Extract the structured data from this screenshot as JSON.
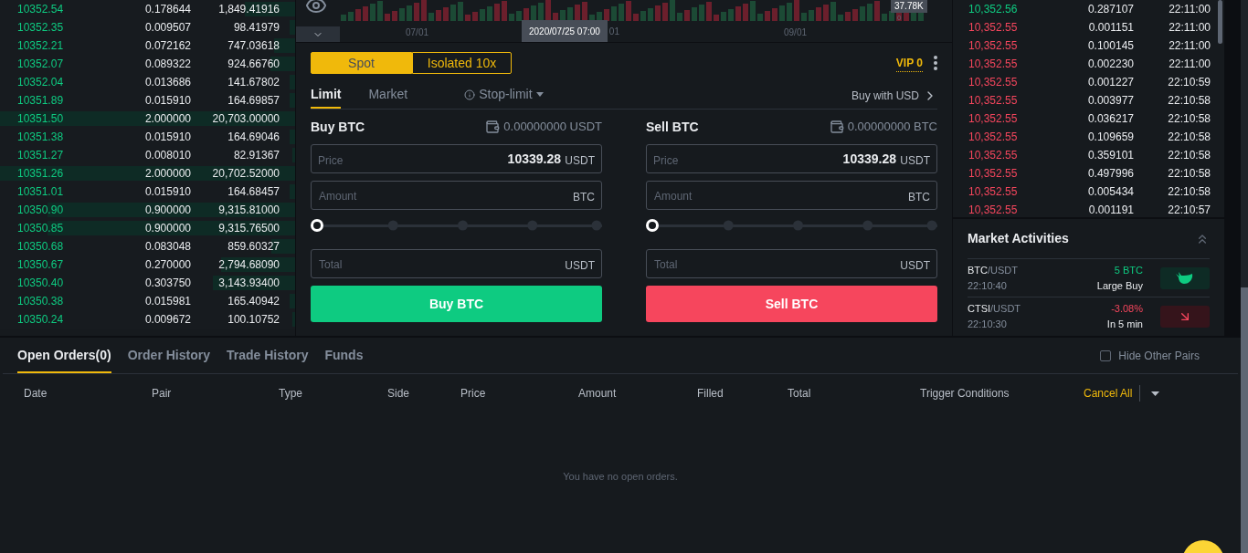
{
  "order_book": {
    "rows": [
      {
        "price": "10352.54",
        "amount": "0.178644",
        "total": "1,849.41916",
        "level": 0.17
      },
      {
        "price": "10352.35",
        "amount": "0.009507",
        "total": "98.41979",
        "level": 0.02
      },
      {
        "price": "10352.21",
        "amount": "0.072162",
        "total": "747.03618",
        "level": 0.07
      },
      {
        "price": "10352.07",
        "amount": "0.089322",
        "total": "924.66760",
        "level": 0.085
      },
      {
        "price": "10352.04",
        "amount": "0.013686",
        "total": "141.67802",
        "level": 0.02
      },
      {
        "price": "10351.89",
        "amount": "0.015910",
        "total": "164.69857",
        "level": 0.02
      },
      {
        "price": "10351.50",
        "amount": "2.000000",
        "total": "20,703.00000",
        "level": 1
      },
      {
        "price": "10351.38",
        "amount": "0.015910",
        "total": "164.69046",
        "level": 0.02
      },
      {
        "price": "10351.27",
        "amount": "0.008010",
        "total": "82.91367",
        "level": 0.01
      },
      {
        "price": "10351.26",
        "amount": "2.000000",
        "total": "20,702.52000",
        "level": 1
      },
      {
        "price": "10351.01",
        "amount": "0.015910",
        "total": "164.68457",
        "level": 0.02
      },
      {
        "price": "10350.90",
        "amount": "0.900000",
        "total": "9,315.81000",
        "level": 0.84
      },
      {
        "price": "10350.85",
        "amount": "0.900000",
        "total": "9,315.76500",
        "level": 0.84
      },
      {
        "price": "10350.68",
        "amount": "0.083048",
        "total": "859.60327",
        "level": 0.08
      },
      {
        "price": "10350.67",
        "amount": "0.270000",
        "total": "2,794.68090",
        "level": 0.25
      },
      {
        "price": "10350.40",
        "amount": "0.303750",
        "total": "3,143.93400",
        "level": 0.28
      },
      {
        "price": "10350.38",
        "amount": "0.015981",
        "total": "165.40942",
        "level": 0.02
      },
      {
        "price": "10350.24",
        "amount": "0.009672",
        "total": "100.10752",
        "level": 0.01
      }
    ]
  },
  "chart": {
    "x_labels": [
      "07/01",
      "01",
      "09/01"
    ],
    "crosshair_time": "2020/07/25 07:00",
    "price_tag": "37.78K",
    "axis_value": "0"
  },
  "order_form": {
    "modes": [
      {
        "label": "Spot",
        "selected": true
      },
      {
        "label": "Isolated 10x",
        "selected": false
      }
    ],
    "vip": "VIP 0",
    "order_types": [
      {
        "label": "Limit",
        "selected": true
      },
      {
        "label": "Market",
        "selected": false
      },
      {
        "label": "Stop-limit",
        "selected": false
      }
    ],
    "buy_with": "Buy with USD",
    "sides": [
      {
        "kind": "buy",
        "title": "Buy BTC",
        "balance": "0.00000000 USDT",
        "price": {
          "label": "Price",
          "value": "10339.28",
          "unit": "USDT"
        },
        "amount": {
          "placeholder": "Amount",
          "unit": "BTC"
        },
        "slider": {
          "level": 0
        },
        "total": {
          "placeholder": "Total",
          "unit": "USDT"
        },
        "button": "Buy BTC"
      },
      {
        "kind": "sell",
        "title": "Sell BTC",
        "balance": "0.00000000 BTC",
        "price": {
          "label": "Price",
          "value": "10339.28",
          "unit": "USDT"
        },
        "amount": {
          "placeholder": "Amount",
          "unit": "BTC"
        },
        "slider": {
          "level": 0
        },
        "total": {
          "placeholder": "Total",
          "unit": "USDT"
        },
        "button": "Sell BTC"
      }
    ]
  },
  "trades": [
    {
      "kind": "buy",
      "price": "10,352.56",
      "amount": "0.287107",
      "time": "22:11:00"
    },
    {
      "kind": "sell",
      "price": "10,352.55",
      "amount": "0.001151",
      "time": "22:11:00"
    },
    {
      "kind": "sell",
      "price": "10,352.55",
      "amount": "0.100145",
      "time": "22:11:00"
    },
    {
      "kind": "sell",
      "price": "10,352.55",
      "amount": "0.002230",
      "time": "22:11:00"
    },
    {
      "kind": "sell",
      "price": "10,352.55",
      "amount": "0.001227",
      "time": "22:10:59"
    },
    {
      "kind": "sell",
      "price": "10,352.55",
      "amount": "0.003977",
      "time": "22:10:58"
    },
    {
      "kind": "sell",
      "price": "10,352.55",
      "amount": "0.036217",
      "time": "22:10:58"
    },
    {
      "kind": "sell",
      "price": "10,352.55",
      "amount": "0.109659",
      "time": "22:10:58"
    },
    {
      "kind": "sell",
      "price": "10,352.55",
      "amount": "0.359101",
      "time": "22:10:58"
    },
    {
      "kind": "sell",
      "price": "10,352.55",
      "amount": "0.497996",
      "time": "22:10:58"
    },
    {
      "kind": "sell",
      "price": "10,352.55",
      "amount": "0.005434",
      "time": "22:10:58"
    },
    {
      "kind": "sell",
      "price": "10,352.55",
      "amount": "0.001191",
      "time": "22:10:57"
    }
  ],
  "market_activities": {
    "title": "Market Activities",
    "items": [
      {
        "kind": "large_buy",
        "base": "BTC",
        "quote": "/USDT",
        "time": "22:10:40",
        "value": "5 BTC",
        "label": "Large Buy"
      },
      {
        "kind": "drop",
        "base": "CTSI",
        "quote": "/USDT",
        "time": "22:10:30",
        "value": "-3.08%",
        "label": "In 5 min"
      }
    ]
  },
  "orders": {
    "tabs": [
      {
        "label": "Open Orders(0)",
        "selected": true
      },
      {
        "label": "Order History",
        "selected": false
      },
      {
        "label": "Trade History",
        "selected": false
      },
      {
        "label": "Funds",
        "selected": false
      }
    ],
    "hide_other_pairs": {
      "label": "Hide Other Pairs",
      "checked": false
    },
    "columns": [
      "Date",
      "Pair",
      "Type",
      "Side",
      "Price",
      "Amount",
      "Filled",
      "Total",
      "Trigger Conditions"
    ],
    "cancel_all": "Cancel All",
    "empty_message": "You have no open orders."
  }
}
